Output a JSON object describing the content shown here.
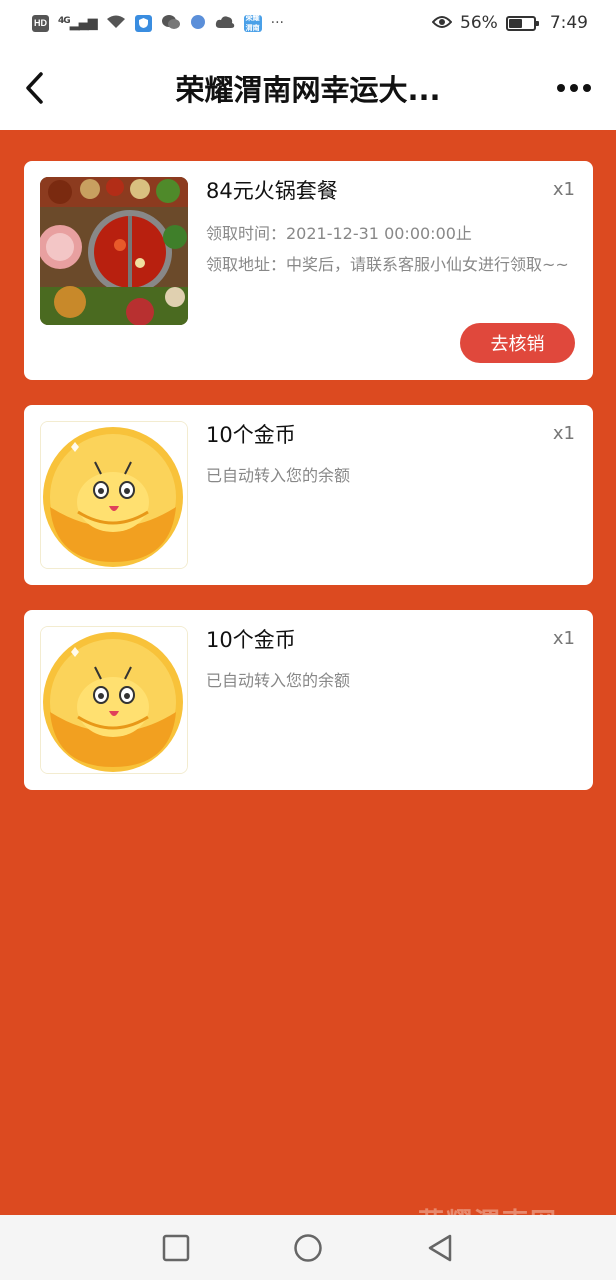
{
  "status_bar": {
    "hd_label": "HD",
    "network_label": "4G",
    "battery_text": "56%",
    "time": "7:49",
    "more_indicator": "···",
    "app_badge_text": "荣耀渭南",
    "battery_level": 0.56
  },
  "nav": {
    "title": "荣耀渭南网幸运大..."
  },
  "prizes": [
    {
      "name": "84元火锅套餐",
      "qty": "x1",
      "time_label": "领取时间：2021-12-31 00:00:00止",
      "address_label": "领取地址：中奖后，请联系客服小仙女进行领取~~",
      "button_label": "去核销",
      "thumb_icon": "hotpot-image"
    },
    {
      "name": "10个金币",
      "qty": "x1",
      "note": "已自动转入您的余额",
      "thumb_icon": "gold-coin-image"
    },
    {
      "name": "10个金币",
      "qty": "x1",
      "note": "已自动转入您的余额",
      "thumb_icon": "gold-coin-image"
    }
  ],
  "watermark": "荣耀渭南网",
  "colors": {
    "background": "#dc4a20",
    "button": "#e0483c",
    "card": "#ffffff"
  }
}
